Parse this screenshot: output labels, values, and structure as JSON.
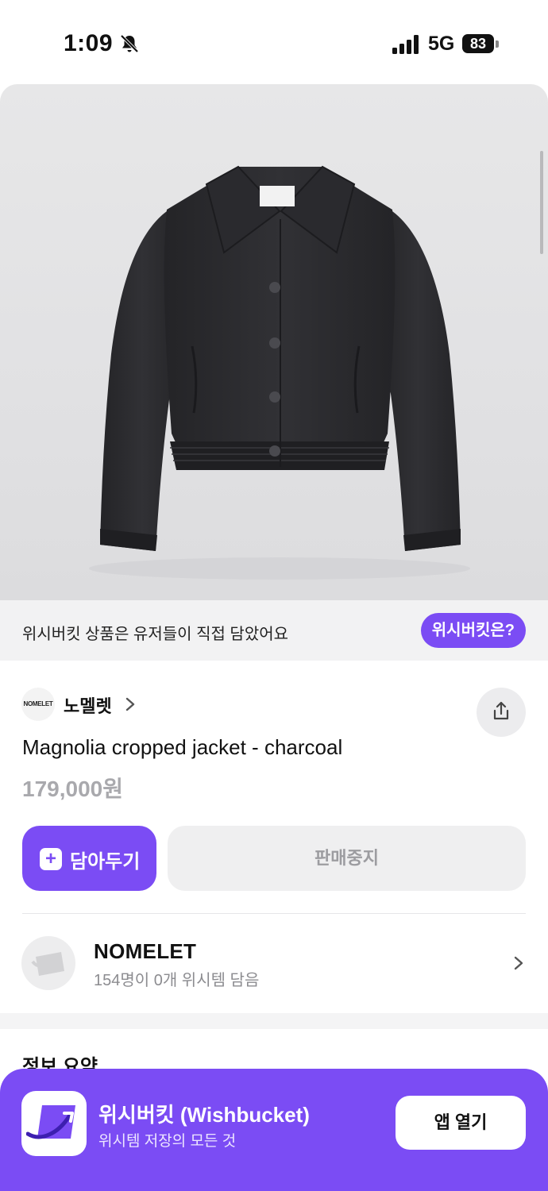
{
  "status_bar": {
    "time": "1:09",
    "network": "5G",
    "battery": "83"
  },
  "banner": {
    "text": "위시버킷 상품은 유저들이 직접 담았어요",
    "button_label": "위시버킷은?"
  },
  "brand": {
    "logo_text": "NOMELET",
    "name": "노멜렛"
  },
  "product": {
    "title": "Magnolia cropped jacket - charcoal",
    "price": "179,000원"
  },
  "actions": {
    "save_label": "담아두기",
    "save_plus": "+",
    "status_label": "판매중지"
  },
  "store": {
    "name": "NOMELET",
    "stats": "154명이 0개 위시템 담음"
  },
  "section": {
    "summary_title": "정보 요약"
  },
  "app_banner": {
    "name": "위시버킷 (Wishbucket)",
    "tagline": "위시템 저장의 모든 것",
    "open_label": "앱 열기"
  },
  "colors": {
    "accent": "#7b4cf4",
    "price_gray": "#a9a9ad",
    "jacket": "#2b2b2e"
  },
  "icons": [
    "bell-slash-icon",
    "signal-icon",
    "battery-icon",
    "chevron-right-icon",
    "share-icon",
    "plus-icon",
    "store-icon",
    "app-logo-icon"
  ]
}
